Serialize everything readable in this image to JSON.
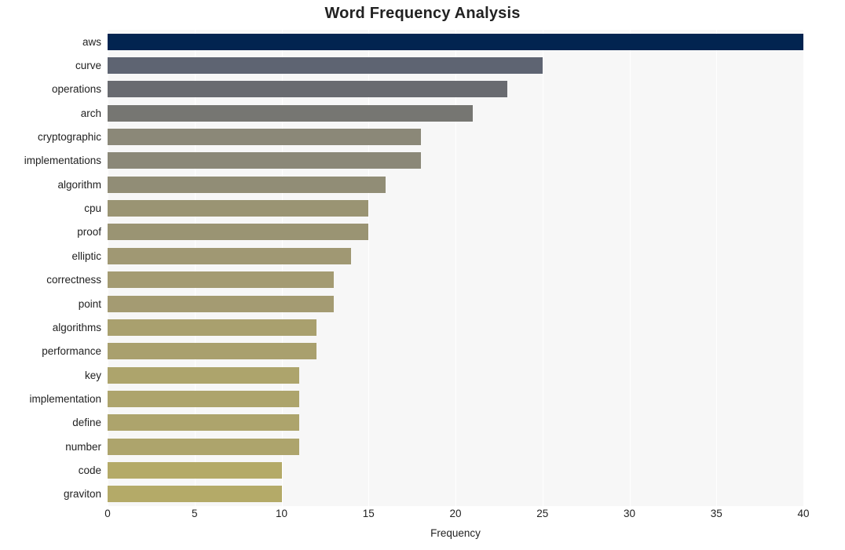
{
  "chart_data": {
    "type": "bar",
    "orientation": "horizontal",
    "title": "Word Frequency Analysis",
    "xlabel": "Frequency",
    "ylabel": "",
    "xlim": [
      0,
      40
    ],
    "xticks": [
      0,
      5,
      10,
      15,
      20,
      25,
      30,
      35,
      40
    ],
    "grid": true,
    "grid_axis": "x",
    "legend": false,
    "categories": [
      "aws",
      "curve",
      "operations",
      "arch",
      "cryptographic",
      "implementations",
      "algorithm",
      "cpu",
      "proof",
      "elliptic",
      "correctness",
      "point",
      "algorithms",
      "performance",
      "key",
      "implementation",
      "define",
      "number",
      "code",
      "graviton"
    ],
    "values": [
      40,
      25,
      23,
      21,
      18,
      18,
      16,
      15,
      15,
      14,
      13,
      13,
      12,
      12,
      11,
      11,
      11,
      11,
      10,
      10
    ],
    "bar_colors": [
      "#022450",
      "#5e6472",
      "#696b70",
      "#767672",
      "#8b8878",
      "#8b8878",
      "#918d76",
      "#9a9473",
      "#9a9473",
      "#a09873",
      "#a49b72",
      "#a49b72",
      "#a9a06e",
      "#a9a06e",
      "#ada46c",
      "#ada46c",
      "#ada46c",
      "#ada46c",
      "#b4aa68",
      "#b4aa68"
    ]
  },
  "style": {
    "plot_background": "#f7f7f7",
    "figure_background": "#ffffff",
    "gridline_color": "#ffffff",
    "text_color": "#222222"
  }
}
